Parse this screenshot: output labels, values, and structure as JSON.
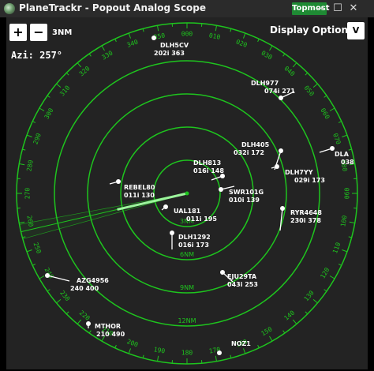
{
  "window": {
    "title": "PlaneTrackr - Popout Analog Scope",
    "topmost_label": "Topmost",
    "min_glyph": "—",
    "max_glyph": "☐",
    "close_glyph": "✕"
  },
  "toolbar": {
    "zoom_in": "+",
    "zoom_out": "−",
    "range": "3NM",
    "display_options": "Display Options",
    "collapse": "V"
  },
  "readout": {
    "azimuth": "Azi: 257°"
  },
  "colors": {
    "scope_green": "#1ec51e",
    "beam": "#9cf59c",
    "background": "#232323",
    "topmost": "#1f8a34"
  },
  "scope": {
    "ring_labels": [
      "3NM",
      "6NM",
      "9NM",
      "12NM"
    ],
    "bearing_labels": [
      "000",
      "010",
      "020",
      "030",
      "040",
      "050",
      "060",
      "070",
      "080",
      "090",
      "100",
      "110",
      "120",
      "130",
      "140",
      "150",
      "160",
      "170",
      "180",
      "190",
      "200",
      "210",
      "220",
      "230",
      "240",
      "250",
      "260",
      "270",
      "280",
      "290",
      "300",
      "310",
      "320",
      "330",
      "340",
      "350"
    ],
    "beam_azimuth": 257
  },
  "targets": [
    {
      "callsign": "DLH5CV",
      "info": "202i 363"
    },
    {
      "callsign": "DLH977",
      "info": "074i 271"
    },
    {
      "callsign": "DLH405",
      "info": "032i 172"
    },
    {
      "callsign": "DLA",
      "info": "038"
    },
    {
      "callsign": "DLH813",
      "info": "016i 148"
    },
    {
      "callsign": "DLH7YY",
      "info": "029i 173"
    },
    {
      "callsign": "REBEL80",
      "info": "011i 130"
    },
    {
      "callsign": "SWR101G",
      "info": "010i 139"
    },
    {
      "callsign": "UAL181",
      "info": "011i 195"
    },
    {
      "callsign": "RYR4648",
      "info": "230i 378"
    },
    {
      "callsign": "DLH1292",
      "info": "016i 173"
    },
    {
      "callsign": "EJU29TA",
      "info": "043i 253"
    },
    {
      "callsign": "AZG4956",
      "info": "240 400"
    },
    {
      "callsign": "MTHOR",
      "info": "210 490"
    },
    {
      "callsign": "NOZ1",
      "info": ""
    }
  ]
}
